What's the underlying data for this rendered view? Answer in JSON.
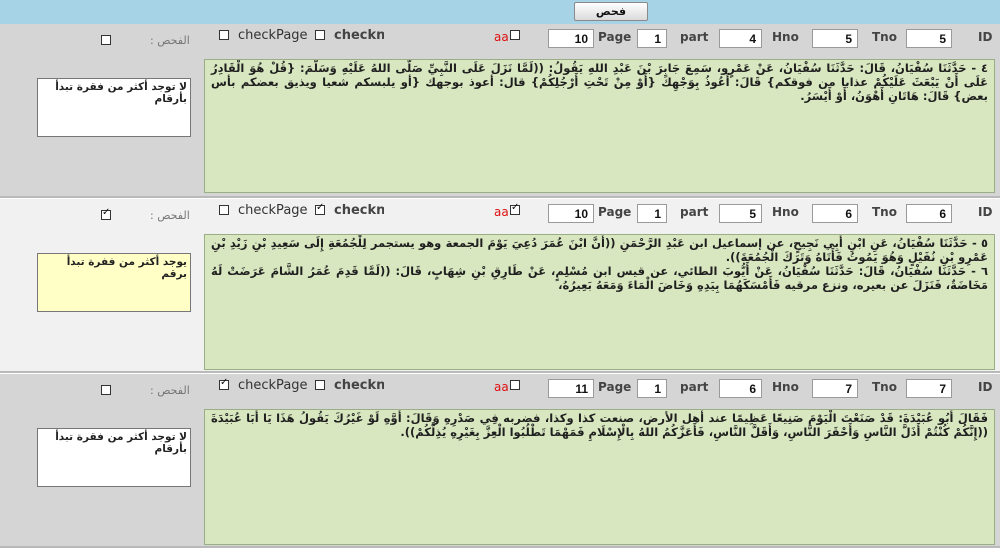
{
  "toolbar": {
    "check_label": "فحص"
  },
  "labels": {
    "check_page": "checkPage",
    "checknc": "checknc",
    "aa": "aa",
    "page": "Page",
    "part": "part",
    "hno": "Hno",
    "tno": "Tno",
    "id": "ID",
    "fahs": "الفحص :"
  },
  "records": [
    {
      "check_page": false,
      "checknc": false,
      "aa": false,
      "fahs": false,
      "page": "10",
      "part": "1",
      "hno": "4",
      "tno": "5",
      "id": "5",
      "text": [
        "٤ - حَدَّثَنَا سُفْيَانُ، قَالَ: حَدَّثَنَا سُفْيَانُ، عَنْ عَمْرٍو، سَمِعَ جَابِرَ بْنَ عَبْدِ اللهِ يَقُولُ: ((لَمَّا نَزَلَ عَلَى النَّبِيِّ صَلَّى اللهُ عَلَيْهِ وَسَلَّمَ: {قُلْ هُوَ الْقَادِرُ عَلَى أَنْ يَبْعَثَ عَلَيْكُمْ عذابا من فوقكم} قَالَ: أَعُوذُ بِوَجْهِكَ {أَوْ مِنْ تَحْتِ أَرْجُلِكُمْ} قال: أعوذ بوجهك {أو يلبسكم شعيا ويذيق بعضكم بأس بعض} قَالَ: هَاتَانِ أَهْوَنُ، أَوْ أَيْسَرُ."
      ],
      "note": "لا توجد أكثر من فقرة تبدأ بأرقام"
    },
    {
      "check_page": false,
      "checknc": true,
      "aa": true,
      "fahs": true,
      "page": "10",
      "part": "1",
      "hno": "5",
      "tno": "6",
      "id": "6",
      "text": [
        "٥ - حَدَّثَنَا سُفْيَانُ، عَنِ ابْنِ أَبِي نَجِيحٍ، عن إسماعيل ابن عَبْدِ الرَّحْمَنِ ((أَنَّ ابْنَ عُمَرَ دُعِيَ يَوْمَ الجمعة وهو يستجمر لِلْجُمُعَةِ إِلَى سَعِيدِ بْنِ زَيْدِ بْنِ عَمْرِو بْنِ نُفَيْلٍ وَهُوَ يَمُوتُ فَأَتَاهُ وَتَرَكَ الْجُمُعَةَ)).",
        "٦ - حَدَّثَنَا سُفْيَانُ، قَالَ: حَدَّثَنَا سُفْيَانُ، عَنْ أَيُّوبَ الطائي، عن قيس ابن مُسْلِمٍ، عَنْ طَارِقِ بْنِ شِهَابٍ، قَالَ: ((لَمَّا قَدِمَ عُمَرُ الشَّامَ عَرَضَتْ لَهُ مَخَاضَةٌ، فَنَزَلَ عن بعيره، ونزع مرقيه فَأَمْسَكَهُمَا بِيَدِهِ وَخَاضَ الْمَاءَ وَمَعَهُ بَعِيرُهُ،"
      ],
      "note": "يوجد أكثر من ففرة تبدأ برقم"
    },
    {
      "check_page": true,
      "checknc": false,
      "aa": false,
      "fahs": false,
      "page": "11",
      "part": "1",
      "hno": "6",
      "tno": "7",
      "id": "7",
      "text": [
        "فَقَالَ أَبُو عُبَيْدَةَ: قَدْ صَنَعْتَ الْيَوْمَ صَنِيعًا عَظِيمًا عند أهل الأرض، صنعت كذا وكذا، فضربه فِي صَدْرِهِ وَقَالَ: أَوَّهِ لَوْ غَيْرُكَ يَقُولُ هَذَا يَا أَبَا عُبَيْدَةَ ((إِنَّكُمْ كُنْتُمْ أَذَلَّ النَّاسِ وَأَحْقَرَ النَّاسِ، وَأَقَلَّ النَّاسِ، فَأَعَزَّكُمُ اللهُ بِالْإِسْلَامِ فَمَهْمَا تَطْلُبُوا الْعِزَّ بِغَيْرِهِ يُذِلَّكُمْ))."
      ],
      "note": "لا توجد أكثر من فقرة تبدأ بأرقام"
    }
  ]
}
